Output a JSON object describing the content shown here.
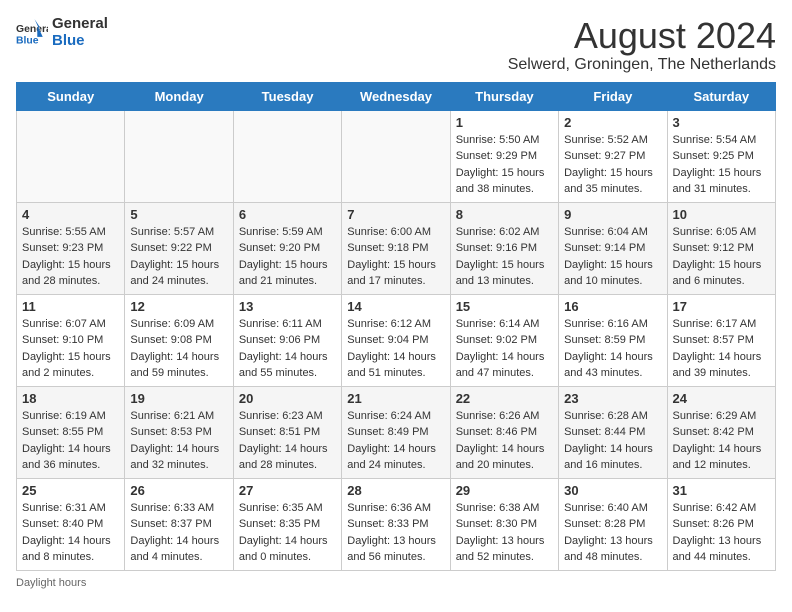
{
  "logo": {
    "general": "General",
    "blue": "Blue"
  },
  "title": "August 2024",
  "subtitle": "Selwerd, Groningen, The Netherlands",
  "days_of_week": [
    "Sunday",
    "Monday",
    "Tuesday",
    "Wednesday",
    "Thursday",
    "Friday",
    "Saturday"
  ],
  "weeks": [
    [
      {
        "day": "",
        "info": "",
        "empty": true
      },
      {
        "day": "",
        "info": "",
        "empty": true
      },
      {
        "day": "",
        "info": "",
        "empty": true
      },
      {
        "day": "",
        "info": "",
        "empty": true
      },
      {
        "day": "1",
        "info": "Sunrise: 5:50 AM\nSunset: 9:29 PM\nDaylight: 15 hours\nand 38 minutes."
      },
      {
        "day": "2",
        "info": "Sunrise: 5:52 AM\nSunset: 9:27 PM\nDaylight: 15 hours\nand 35 minutes."
      },
      {
        "day": "3",
        "info": "Sunrise: 5:54 AM\nSunset: 9:25 PM\nDaylight: 15 hours\nand 31 minutes."
      }
    ],
    [
      {
        "day": "4",
        "info": "Sunrise: 5:55 AM\nSunset: 9:23 PM\nDaylight: 15 hours\nand 28 minutes."
      },
      {
        "day": "5",
        "info": "Sunrise: 5:57 AM\nSunset: 9:22 PM\nDaylight: 15 hours\nand 24 minutes."
      },
      {
        "day": "6",
        "info": "Sunrise: 5:59 AM\nSunset: 9:20 PM\nDaylight: 15 hours\nand 21 minutes."
      },
      {
        "day": "7",
        "info": "Sunrise: 6:00 AM\nSunset: 9:18 PM\nDaylight: 15 hours\nand 17 minutes."
      },
      {
        "day": "8",
        "info": "Sunrise: 6:02 AM\nSunset: 9:16 PM\nDaylight: 15 hours\nand 13 minutes."
      },
      {
        "day": "9",
        "info": "Sunrise: 6:04 AM\nSunset: 9:14 PM\nDaylight: 15 hours\nand 10 minutes."
      },
      {
        "day": "10",
        "info": "Sunrise: 6:05 AM\nSunset: 9:12 PM\nDaylight: 15 hours\nand 6 minutes."
      }
    ],
    [
      {
        "day": "11",
        "info": "Sunrise: 6:07 AM\nSunset: 9:10 PM\nDaylight: 15 hours\nand 2 minutes."
      },
      {
        "day": "12",
        "info": "Sunrise: 6:09 AM\nSunset: 9:08 PM\nDaylight: 14 hours\nand 59 minutes."
      },
      {
        "day": "13",
        "info": "Sunrise: 6:11 AM\nSunset: 9:06 PM\nDaylight: 14 hours\nand 55 minutes."
      },
      {
        "day": "14",
        "info": "Sunrise: 6:12 AM\nSunset: 9:04 PM\nDaylight: 14 hours\nand 51 minutes."
      },
      {
        "day": "15",
        "info": "Sunrise: 6:14 AM\nSunset: 9:02 PM\nDaylight: 14 hours\nand 47 minutes."
      },
      {
        "day": "16",
        "info": "Sunrise: 6:16 AM\nSunset: 8:59 PM\nDaylight: 14 hours\nand 43 minutes."
      },
      {
        "day": "17",
        "info": "Sunrise: 6:17 AM\nSunset: 8:57 PM\nDaylight: 14 hours\nand 39 minutes."
      }
    ],
    [
      {
        "day": "18",
        "info": "Sunrise: 6:19 AM\nSunset: 8:55 PM\nDaylight: 14 hours\nand 36 minutes."
      },
      {
        "day": "19",
        "info": "Sunrise: 6:21 AM\nSunset: 8:53 PM\nDaylight: 14 hours\nand 32 minutes."
      },
      {
        "day": "20",
        "info": "Sunrise: 6:23 AM\nSunset: 8:51 PM\nDaylight: 14 hours\nand 28 minutes."
      },
      {
        "day": "21",
        "info": "Sunrise: 6:24 AM\nSunset: 8:49 PM\nDaylight: 14 hours\nand 24 minutes."
      },
      {
        "day": "22",
        "info": "Sunrise: 6:26 AM\nSunset: 8:46 PM\nDaylight: 14 hours\nand 20 minutes."
      },
      {
        "day": "23",
        "info": "Sunrise: 6:28 AM\nSunset: 8:44 PM\nDaylight: 14 hours\nand 16 minutes."
      },
      {
        "day": "24",
        "info": "Sunrise: 6:29 AM\nSunset: 8:42 PM\nDaylight: 14 hours\nand 12 minutes."
      }
    ],
    [
      {
        "day": "25",
        "info": "Sunrise: 6:31 AM\nSunset: 8:40 PM\nDaylight: 14 hours\nand 8 minutes."
      },
      {
        "day": "26",
        "info": "Sunrise: 6:33 AM\nSunset: 8:37 PM\nDaylight: 14 hours\nand 4 minutes."
      },
      {
        "day": "27",
        "info": "Sunrise: 6:35 AM\nSunset: 8:35 PM\nDaylight: 14 hours\nand 0 minutes."
      },
      {
        "day": "28",
        "info": "Sunrise: 6:36 AM\nSunset: 8:33 PM\nDaylight: 13 hours\nand 56 minutes."
      },
      {
        "day": "29",
        "info": "Sunrise: 6:38 AM\nSunset: 8:30 PM\nDaylight: 13 hours\nand 52 minutes."
      },
      {
        "day": "30",
        "info": "Sunrise: 6:40 AM\nSunset: 8:28 PM\nDaylight: 13 hours\nand 48 minutes."
      },
      {
        "day": "31",
        "info": "Sunrise: 6:42 AM\nSunset: 8:26 PM\nDaylight: 13 hours\nand 44 minutes."
      }
    ]
  ],
  "footer": "Daylight hours"
}
